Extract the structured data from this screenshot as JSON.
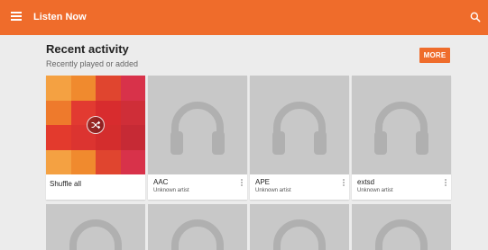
{
  "appbar": {
    "title": "Listen Now",
    "menu_icon": "menu-icon",
    "search_icon": "search-icon",
    "color": "#ef6c2b"
  },
  "section": {
    "title": "Recent activity",
    "subtitle": "Recently played or added",
    "more_label": "MORE"
  },
  "cards": [
    {
      "name": "Shuffle all",
      "artist": ""
    },
    {
      "name": "AAC",
      "artist": "Unknown artist"
    },
    {
      "name": "APE",
      "artist": "Unknown artist"
    },
    {
      "name": "extsd",
      "artist": "Unknown artist"
    }
  ],
  "mosaic_colors": [
    "#f4a142",
    "#f08a2e",
    "#e0452f",
    "#d8324a",
    "#ee7a2c",
    "#e23a31",
    "#d82c2e",
    "#cf2e38",
    "#e33a2d",
    "#dc3430",
    "#d42d2d",
    "#c62a35",
    "#f4a142",
    "#f08a2e",
    "#e0452f",
    "#d8324a"
  ]
}
